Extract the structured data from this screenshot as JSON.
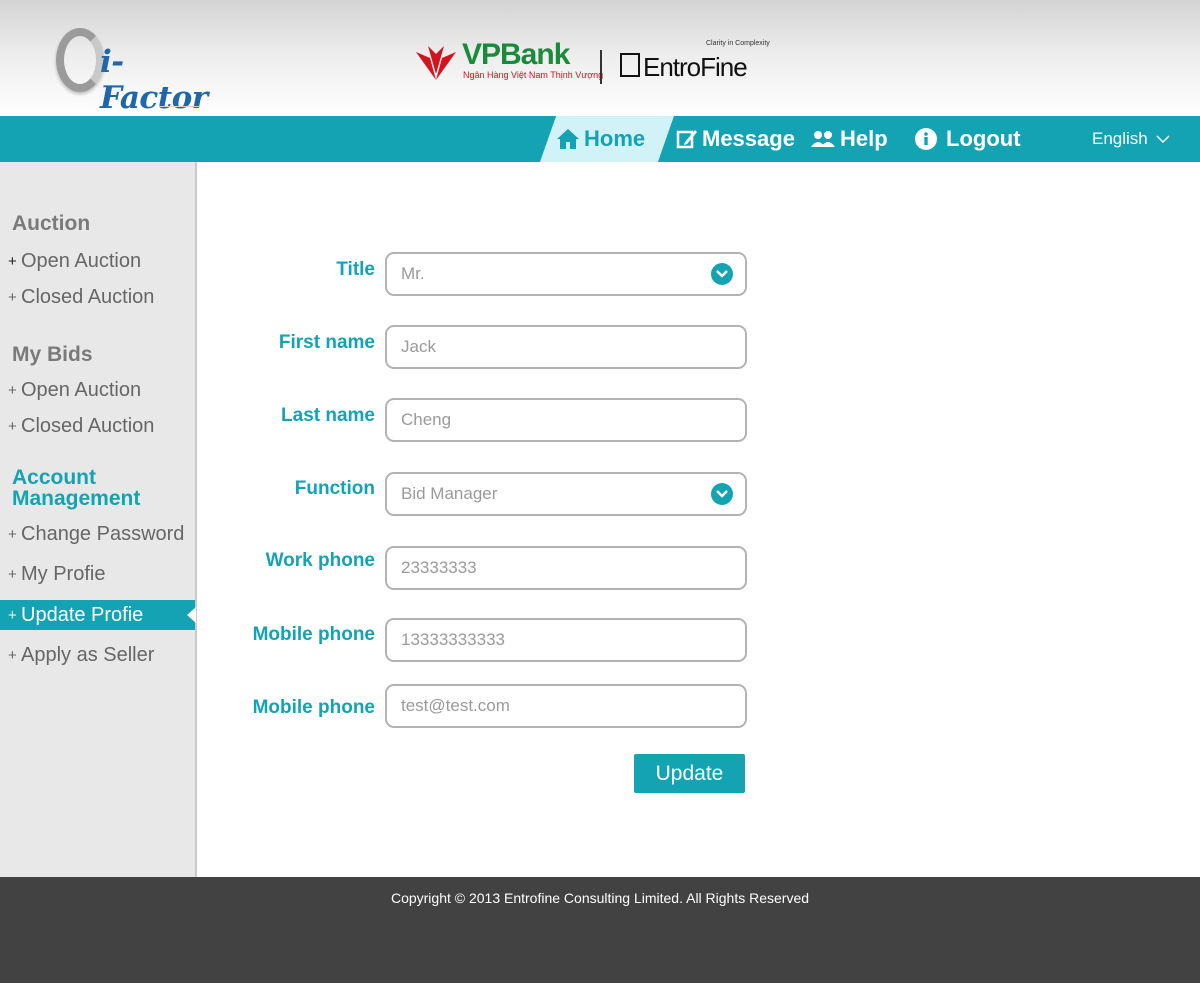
{
  "header": {
    "logo_text": "i-Factor",
    "partner_bank": {
      "name": "VPBank",
      "tagline": "Ngân Hàng Việt Nam Thịnh Vượng"
    },
    "partner_consulting": {
      "name": "EntroFine",
      "tagline": "Clarity in Complexity",
      "box_label": "ENTROFINE"
    }
  },
  "nav": {
    "home": "Home",
    "message": "Message",
    "help": "Help",
    "logout": "Logout",
    "language": "English"
  },
  "sidebar": {
    "auction_heading": "Auction",
    "auction_items": [
      "Open Auction",
      "Closed Auction"
    ],
    "bids_heading": "My Bids",
    "bids_items": [
      "Open Auction",
      "Closed Auction"
    ],
    "account_heading_line1": "Account",
    "account_heading_line2": "Management",
    "account_items": [
      "Change Password",
      "My Profie",
      "Update Profie",
      "Apply as Seller"
    ],
    "plus": "+"
  },
  "form": {
    "fields": [
      {
        "label": "Title",
        "value": "Mr."
      },
      {
        "label": "First name",
        "value": "Jack"
      },
      {
        "label": "Last name",
        "value": "Cheng"
      },
      {
        "label": "Function",
        "value": "Bid Manager"
      },
      {
        "label": "Work phone",
        "value": "23333333"
      },
      {
        "label": "Mobile phone",
        "value": "13333333333"
      },
      {
        "label": "Mobile phone",
        "value": "test@test.com"
      }
    ],
    "submit_label": "Update"
  },
  "footer": {
    "copyright": "Copyright © 2013 Entrofine Consulting Limited. All Rights Reserved"
  },
  "colors": {
    "accent": "#14a3b3",
    "nav_active_bg": "#d1f2f7",
    "sidebar_bg": "#e8e8e8",
    "footer_bg": "#424242",
    "bank_green": "#1b8a3c",
    "bank_red": "#d3141e",
    "logo_blue": "#1f67a9"
  }
}
